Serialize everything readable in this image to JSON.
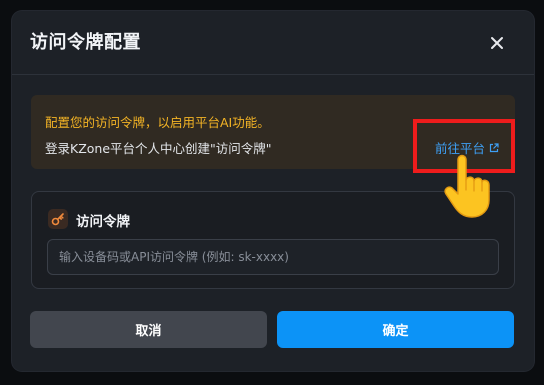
{
  "dialog": {
    "title": "访问令牌配置",
    "close_icon": "close-icon"
  },
  "notice": {
    "line1": "配置您的访问令牌，以启用平台AI功能。",
    "line2": "登录KZone平台个人中心创建\"访问令牌\"",
    "link_label": "前往平台",
    "link_icon": "external-link-icon",
    "warning_color": "#f4b425",
    "link_color": "#3ea0f5"
  },
  "token": {
    "icon": "key-icon",
    "label": "访问令牌",
    "placeholder": "输入设备码或API访问令牌 (例如: sk-xxxx)",
    "value": ""
  },
  "actions": {
    "cancel_label": "取消",
    "confirm_label": "确定",
    "confirm_color": "#0c93f7"
  },
  "annotation": {
    "highlight_color": "#ee1c1c",
    "pointer_icon": "pointing-hand-icon"
  }
}
